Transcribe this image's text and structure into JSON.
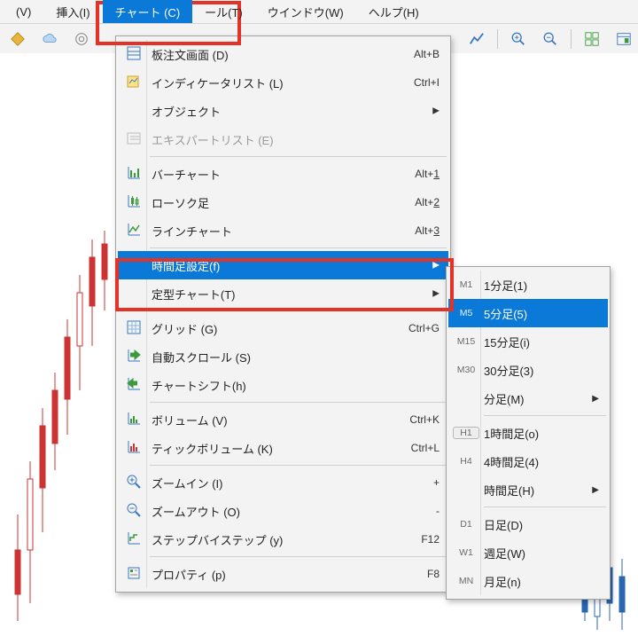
{
  "menubar": {
    "items": [
      {
        "label": "(V)"
      },
      {
        "label": "挿入(I)"
      },
      {
        "label": "チャート (C)"
      },
      {
        "label": "ール(T)"
      },
      {
        "label": "ウインドウ(W)"
      },
      {
        "label": "ヘルプ(H)"
      }
    ],
    "active_index": 2
  },
  "toolbar": {
    "left": [
      "diamond-gold-icon",
      "cloud-icon",
      "target-icon"
    ],
    "right": [
      "line-chart-icon",
      "zoom-in-icon",
      "zoom-out-icon",
      "tiles-icon",
      "panel-icon"
    ]
  },
  "menu": {
    "items": [
      {
        "icon": "orders-window-icon",
        "label": "板注文画面 (D)",
        "shortcut": "Alt+B",
        "arrow": false
      },
      {
        "icon": "indicator-list-icon",
        "label": "インディケータリスト (L)",
        "shortcut": "Ctrl+I",
        "arrow": false
      },
      {
        "icon": null,
        "label": "オブジェクト",
        "shortcut": "",
        "arrow": true
      },
      {
        "icon": "expert-list-icon",
        "label": "エキスパートリスト (E)",
        "shortcut": "",
        "arrow": false,
        "disabled": true
      },
      {
        "sep": true
      },
      {
        "icon": "bar-chart-icon",
        "label": "バーチャート",
        "shortcut_html": "Alt+<u>1</u>",
        "arrow": false
      },
      {
        "icon": "candlestick-icon",
        "label": "ローソク足",
        "shortcut_html": "Alt+<u>2</u>",
        "arrow": false
      },
      {
        "icon": "line-chart2-icon",
        "label": "ラインチャート",
        "shortcut_html": "Alt+<u>3</u>",
        "arrow": false
      },
      {
        "sep": true
      },
      {
        "icon": null,
        "label": "時間足設定(f)",
        "shortcut": "",
        "arrow": true,
        "selected": true
      },
      {
        "icon": null,
        "label": "定型チャート(T)",
        "shortcut": "",
        "arrow": true
      },
      {
        "sep": true
      },
      {
        "icon": "grid-icon",
        "label": "グリッド (G)",
        "shortcut": "Ctrl+G",
        "arrow": false
      },
      {
        "icon": "autoscroll-icon",
        "label": "自動スクロール (S)",
        "shortcut": "",
        "arrow": false
      },
      {
        "icon": "chartshift-icon",
        "label": "チャートシフト(h)",
        "shortcut": "",
        "arrow": false
      },
      {
        "sep": true
      },
      {
        "icon": "volume-icon",
        "label": "ボリューム (V)",
        "shortcut": "Ctrl+K",
        "arrow": false
      },
      {
        "icon": "tickvolume-icon",
        "label": "ティックボリューム (K)",
        "shortcut": "Ctrl+L",
        "arrow": false
      },
      {
        "sep": true
      },
      {
        "icon": "zoomin-icon",
        "label": "ズームイン (I)",
        "shortcut": "+",
        "arrow": false
      },
      {
        "icon": "zoomout-icon",
        "label": "ズームアウト (O)",
        "shortcut": "-",
        "arrow": false
      },
      {
        "icon": "step-icon",
        "label": "ステップバイステップ (y)",
        "shortcut": "F12",
        "arrow": false
      },
      {
        "sep": true
      },
      {
        "icon": "properties-icon",
        "label": "プロパティ (p)",
        "shortcut": "F8",
        "arrow": false
      }
    ]
  },
  "submenu": {
    "items": [
      {
        "code": "M1",
        "label": "1分足(1)"
      },
      {
        "code": "M5",
        "label": "5分足(5)",
        "selected": true
      },
      {
        "code": "M15",
        "label": "15分足(i)"
      },
      {
        "code": "M30",
        "label": "30分足(3)"
      },
      {
        "code": "",
        "label": "分足(M)",
        "arrow": true
      },
      {
        "sep": true
      },
      {
        "code": "H1",
        "label": "1時間足(o)",
        "boxed": true
      },
      {
        "code": "H4",
        "label": "4時間足(4)"
      },
      {
        "code": "",
        "label": "時間足(H)",
        "arrow": true
      },
      {
        "sep": true
      },
      {
        "code": "D1",
        "label": "日足(D)"
      },
      {
        "code": "W1",
        "label": "週足(W)"
      },
      {
        "code": "MN",
        "label": "月足(n)"
      }
    ]
  },
  "colors": {
    "accent": "#0a79d8",
    "highlight": "#e33226",
    "icon_blue": "#3a77c2",
    "icon_green": "#3c9a3c"
  }
}
